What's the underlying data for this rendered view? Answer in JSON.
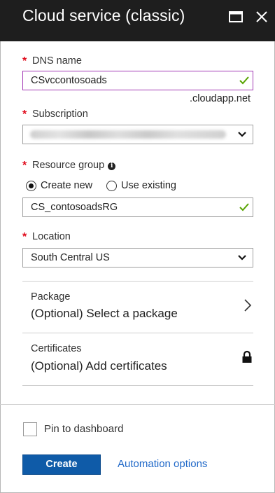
{
  "window": {
    "title": "Cloud service (classic)",
    "maximize_icon": "maximize-icon",
    "close_icon": "close-icon"
  },
  "form": {
    "dns": {
      "label": "DNS name",
      "value": "CSvccontosoads",
      "suffix": ".cloudapp.net",
      "required": "*"
    },
    "subscription": {
      "label": "Subscription",
      "value": "",
      "required": "*"
    },
    "resource_group": {
      "label": "Resource group",
      "required": "*",
      "options": [
        {
          "label": "Create new",
          "selected": true
        },
        {
          "label": "Use existing",
          "selected": false
        }
      ],
      "value": "CS_contosoadsRG"
    },
    "location": {
      "label": "Location",
      "value": "South Central US",
      "required": "*"
    },
    "package": {
      "label": "Package",
      "value": "(Optional) Select a package"
    },
    "certificates": {
      "label": "Certificates",
      "value": "(Optional) Add certificates"
    }
  },
  "footer": {
    "pin_label": "Pin to dashboard",
    "pin_checked": false,
    "create_label": "Create",
    "automation_label": "Automation options"
  },
  "colors": {
    "titlebar": "#1e1e1e",
    "required": "#e00b1c",
    "focus_border": "#a33ab5",
    "valid_check": "#57a300",
    "primary_button": "#0f5ba8",
    "link": "#1f68c8"
  }
}
